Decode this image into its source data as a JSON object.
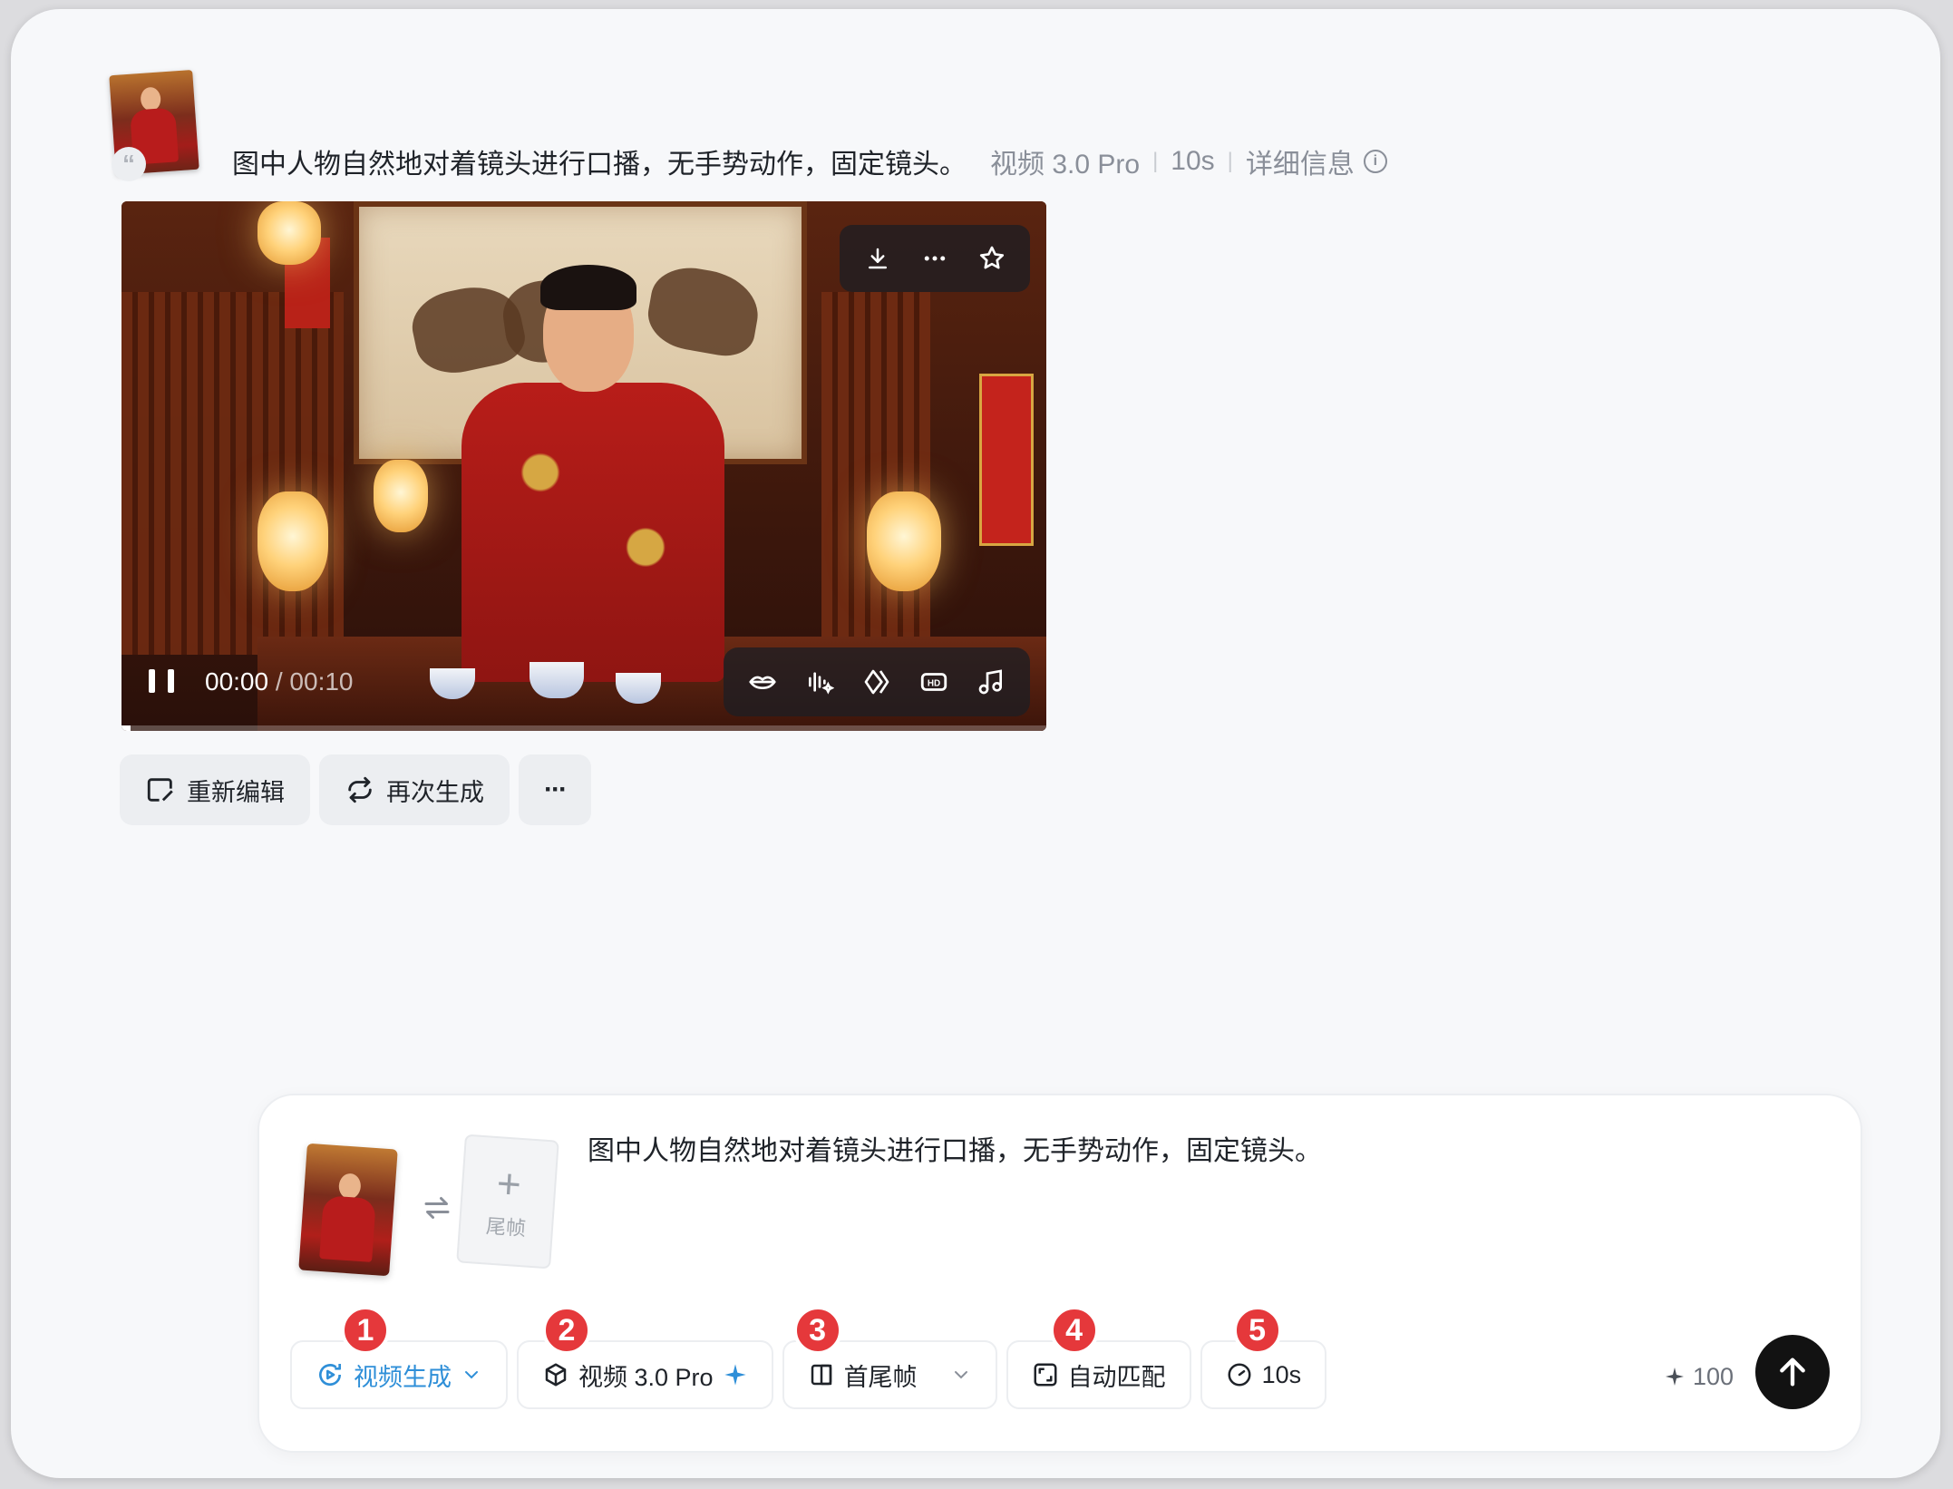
{
  "message": {
    "quote_glyph": "“",
    "prompt": "图中人物自然地对着镜头进行口播，无手势动作，固定镜头。",
    "model": "视频 3.0 Pro",
    "duration": "10s",
    "details_label": "详细信息",
    "info_icon": "i"
  },
  "video": {
    "current_time": "00:00",
    "separator": " / ",
    "total_time": "00:10",
    "progress": 0.01,
    "toolbar_icons": [
      "download-icon",
      "more-icon",
      "star-icon"
    ],
    "control_icons": [
      "lip-sync-icon",
      "audio-wave-icon",
      "frame-interpolation-icon",
      "hd-icon",
      "music-icon"
    ]
  },
  "actions": {
    "reedit_label": "重新编辑",
    "regenerate_label": "再次生成",
    "more_label": "···"
  },
  "composer": {
    "prompt": "图中人物自然地对着镜头进行口播，无手势动作，固定镜头。",
    "last_frame_plus": "+",
    "last_frame_label": "尾帧",
    "chips": {
      "mode_label": "视频生成",
      "model_label": "视频 3.0 Pro",
      "frames_label": "首尾帧",
      "ratio_label": "自动匹配",
      "duration_label": "10s"
    },
    "badges": [
      "1",
      "2",
      "3",
      "4",
      "5"
    ],
    "credits": "100",
    "accent_color": "#2f8fd8",
    "badge_color": "#e5383b"
  }
}
